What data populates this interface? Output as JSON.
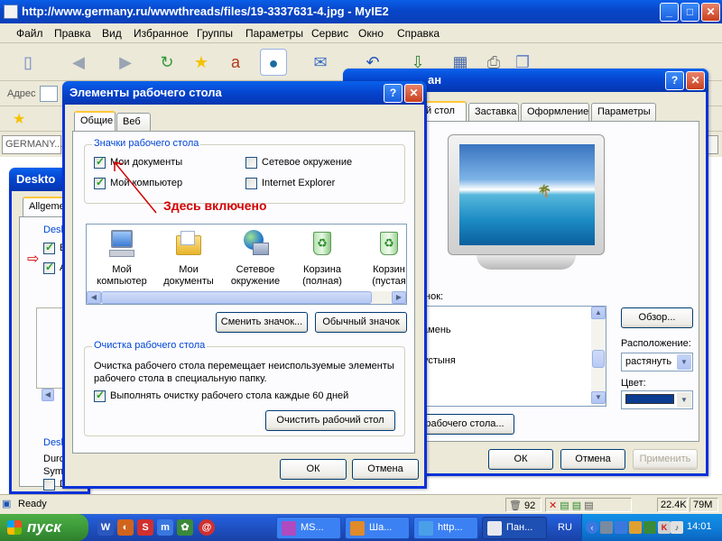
{
  "browser": {
    "title": "http://www.germany.ru/wwwthreads/files/19-3337631-4.jpg - MyIE2",
    "menu": [
      "Файл",
      "Правка",
      "Вид",
      "Избранное",
      "Группы",
      "Параметры",
      "Сервис",
      "Окно",
      "Справка"
    ],
    "address_label": "Адрес",
    "tab_text": "GERMANY...",
    "win_buttons": {
      "minimize": "_",
      "maximize": "□",
      "close": "✕"
    }
  },
  "status": {
    "text": "Ready",
    "count": "92",
    "download": "22.4K",
    "memory": "79M"
  },
  "taskbar": {
    "start_label": "пуск",
    "tasks": [
      "MS...",
      "Ша...",
      "http...",
      "Пан..."
    ],
    "language": "RU",
    "clock": "14:01"
  },
  "background_dialog": {
    "title_partial": "ан",
    "tabs": [
      "й стол",
      "Заставка",
      "Оформление",
      "Параметры"
    ],
    "list_label": "сунок:",
    "list_items": [
      "камень",
      "",
      "пустыня",
      ""
    ],
    "browse_button": "Обзор...",
    "position_label": "Расположение:",
    "position_value": "растянуть",
    "color_label": "Цвет:",
    "customize_button": "рабочего стола...",
    "color": "#0a3d91",
    "ok": "ОК",
    "cancel": "Отмена",
    "apply": "Применить"
  },
  "behind_left_dialog": {
    "title_partial": "Deskto",
    "tab": "Allgeme",
    "group1": "Desk",
    "group2": "Desk",
    "lines": [
      "Durc",
      "Symb"
    ],
    "item_e": "E",
    "item_a": "A",
    "item_d": "D"
  },
  "dialog": {
    "title": "Элементы рабочего стола",
    "help_btn": "?",
    "close_btn": "✕",
    "tabs": [
      "Общие",
      "Веб"
    ],
    "icons_group_label": "Значки рабочего стола",
    "checkboxes": [
      {
        "label": "Мои документы",
        "checked": true
      },
      {
        "label": "Сетевое окружение",
        "checked": false
      },
      {
        "label": "Мой компьютер",
        "checked": true
      },
      {
        "label": "Internet Explorer",
        "checked": false
      }
    ],
    "annotation": "Здесь включено",
    "icons": [
      {
        "line1": "Мой",
        "line2": "компьютер"
      },
      {
        "line1": "Мои",
        "line2": "документы"
      },
      {
        "line1": "Сетевое",
        "line2": "окружение"
      },
      {
        "line1": "Корзина",
        "line2": "(полная)"
      },
      {
        "line1": "Корзин",
        "line2": "(пустая"
      }
    ],
    "change_icon_button": "Сменить значок...",
    "default_icon_button": "Обычный значок",
    "cleanup_group_label": "Очистка рабочего стола",
    "cleanup_text": "Очистка рабочего стола перемещает неиспользуемые элементы рабочего стола в специальную папку.",
    "cleanup_checkbox": {
      "label": "Выполнять очистку рабочего стола каждые 60 дней",
      "checked": true
    },
    "cleanup_now_button": "Очистить рабочий стол",
    "ok": "ОК",
    "cancel": "Отмена",
    "annotation_color": "#d40000"
  }
}
